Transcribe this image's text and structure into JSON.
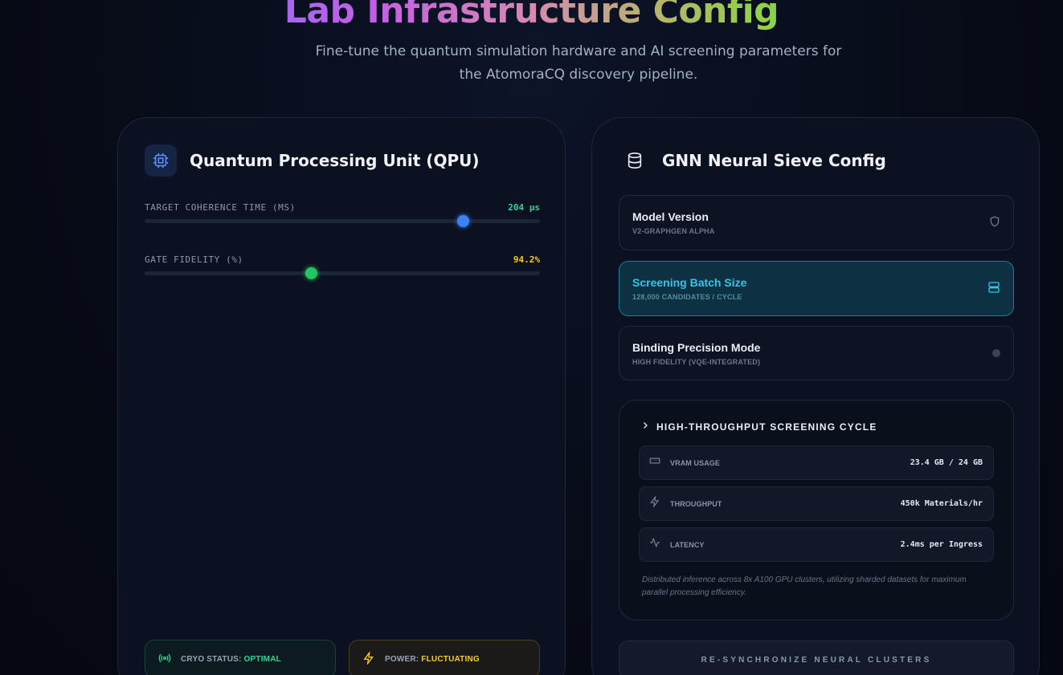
{
  "header": {
    "title": "Lab Infrastructure Config",
    "subtitle": "Fine-tune the quantum simulation hardware and AI screening parameters for the AtomoraCQ discovery pipeline."
  },
  "qpu": {
    "title": "Quantum Processing Unit (QPU)",
    "icon": "cpu-icon",
    "coherence": {
      "label": "TARGET COHERENCE TIME (MS)",
      "value": "204 µs",
      "level": 0.805,
      "color": "#3b82f6",
      "value_color": "#34d399"
    },
    "fidelity": {
      "label": "GATE FIDELITY (%)",
      "value": "94.2%",
      "level": 0.42,
      "color": "#22c55e",
      "value_color": "#facc15"
    },
    "cryo": {
      "label": "CRYO STATUS: ",
      "status": "OPTIMAL",
      "status_color": "#34d399",
      "icon": "radio-signal-icon"
    },
    "power": {
      "label": "POWER: ",
      "status": "FLUCTUATING",
      "status_color": "#facc15",
      "icon": "lightning-icon"
    }
  },
  "gnn": {
    "title": "GNN Neural Sieve Config",
    "icon": "database-icon",
    "options": [
      {
        "title": "Model Version",
        "sub": "V2-GRAPHGEN ALPHA",
        "icon": "shield-icon",
        "active": false
      },
      {
        "title": "Screening Batch Size",
        "sub": "128,000 CANDIDATES / CYCLE",
        "icon": "server-icon",
        "active": true
      },
      {
        "title": "Binding Precision Mode",
        "sub": "HIGH FIDELITY (VQE-INTEGRATED)",
        "icon": "dot-indicator",
        "active": false
      }
    ],
    "cycle": {
      "title": "HIGH-THROUGHPUT SCREENING CYCLE",
      "metrics": [
        {
          "label": "VRAM USAGE",
          "value": "23.4 GB / 24 GB",
          "icon": "memory-icon"
        },
        {
          "label": "THROUGHPUT",
          "value": "450k Materials/hr",
          "icon": "lightning-icon"
        },
        {
          "label": "LATENCY",
          "value": "2.4ms per Ingress",
          "icon": "activity-icon"
        }
      ],
      "note": "Distributed inference across 8x A100 GPU clusters, utilizing sharded datasets for maximum parallel processing efficiency."
    },
    "resync_label": "RE-SYNCHRONIZE NEURAL CLUSTERS"
  }
}
